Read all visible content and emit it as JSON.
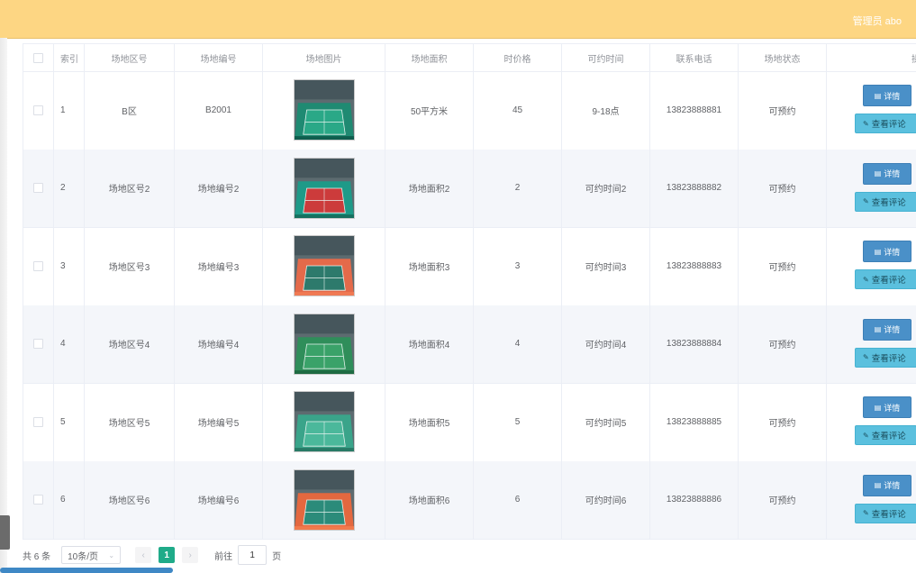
{
  "header": {
    "admin_label": "管理员 abo"
  },
  "table": {
    "columns": [
      "索引",
      "场地区号",
      "场地编号",
      "场地图片",
      "场地面积",
      "时价格",
      "可约时间",
      "联系电话",
      "场地状态",
      "操"
    ],
    "rows": [
      {
        "index": "1",
        "area": "B区",
        "number": "B2001",
        "size": "50平方米",
        "price": "45",
        "time": "9-18点",
        "phone": "13823888881",
        "status": "可预约"
      },
      {
        "index": "2",
        "area": "场地区号2",
        "number": "场地编号2",
        "size": "场地面积2",
        "price": "2",
        "time": "可约时间2",
        "phone": "13823888882",
        "status": "可预约"
      },
      {
        "index": "3",
        "area": "场地区号3",
        "number": "场地编号3",
        "size": "场地面积3",
        "price": "3",
        "time": "可约时间3",
        "phone": "13823888883",
        "status": "可预约"
      },
      {
        "index": "4",
        "area": "场地区号4",
        "number": "场地编号4",
        "size": "场地面积4",
        "price": "4",
        "time": "可约时间4",
        "phone": "13823888884",
        "status": "可预约"
      },
      {
        "index": "5",
        "area": "场地区号5",
        "number": "场地编号5",
        "size": "场地面积5",
        "price": "5",
        "time": "可约时间5",
        "phone": "13823888885",
        "status": "可预约"
      },
      {
        "index": "6",
        "area": "场地区号6",
        "number": "场地编号6",
        "size": "场地面积6",
        "price": "6",
        "time": "可约时间6",
        "phone": "13823888886",
        "status": "可预约"
      }
    ],
    "actions": {
      "detail": "详情",
      "comment": "查看评论"
    }
  },
  "pagination": {
    "total": "共 6 条",
    "page_size": "10条/页",
    "current_page": "1",
    "goto_label": "前往",
    "goto_value": "1",
    "page_suffix": "页"
  },
  "colors": {
    "topbar": "#fdd683",
    "detail_button": "#4a90c8",
    "comment_button": "#5bc0de",
    "active_page": "#1fab89"
  },
  "icons": {
    "detail": "document-icon",
    "comment": "edit-icon"
  }
}
